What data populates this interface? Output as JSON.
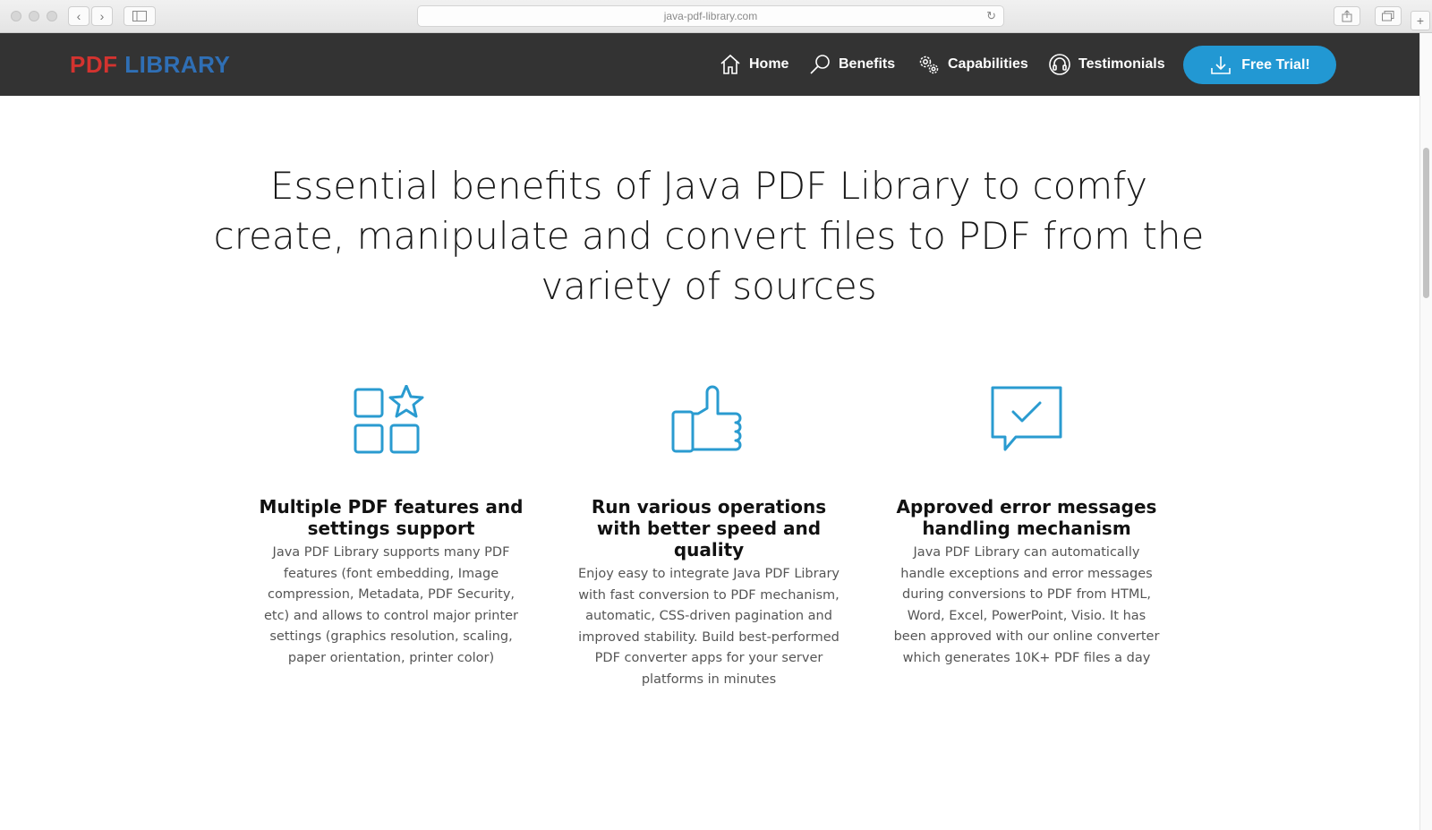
{
  "browser": {
    "url": "java-pdf-library.com"
  },
  "header": {
    "logo_pdf": "PDF",
    "logo_library": "LIBRARY",
    "nav": [
      {
        "label": "Home",
        "icon": "home-icon"
      },
      {
        "label": "Benefits",
        "icon": "search-icon"
      },
      {
        "label": "Capabilities",
        "icon": "gears-icon"
      },
      {
        "label": "Testimonials",
        "icon": "headset-icon"
      }
    ],
    "cta_label": "Free Trial!",
    "cta_icon": "download-icon"
  },
  "main": {
    "headline": "Essential benefits of Java PDF Library to comfy create, manipulate and convert files to PDF from the variety of sources",
    "features": [
      {
        "icon": "grid-star-icon",
        "title": "Multiple PDF features and settings support",
        "text": "Java PDF Library supports many PDF features (font embedding, Image compression, Metadata, PDF Security, etc) and allows to control major printer settings (graphics resolution, scaling, paper orientation, printer color)"
      },
      {
        "icon": "thumbs-up-icon",
        "title": "Run various operations with better speed and quality",
        "text": "Enjoy easy to integrate Java PDF Library with fast conversion to PDF mechanism, automatic, CSS-driven pagination and improved stability. Build best-performed PDF converter apps for your server platforms in minutes"
      },
      {
        "icon": "chat-check-icon",
        "title": "Approved error messages handling mechanism",
        "text": "Java PDF Library can automatically handle exceptions and error messages during conversions to PDF from HTML, Word, Excel, PowerPoint, Visio. It has been approved with our online converter which generates 10K+ PDF files a day"
      }
    ]
  },
  "colors": {
    "header_bg": "#333333",
    "accent": "#2298d3",
    "logo_red": "#d3332f",
    "logo_blue": "#2f6fb5"
  }
}
